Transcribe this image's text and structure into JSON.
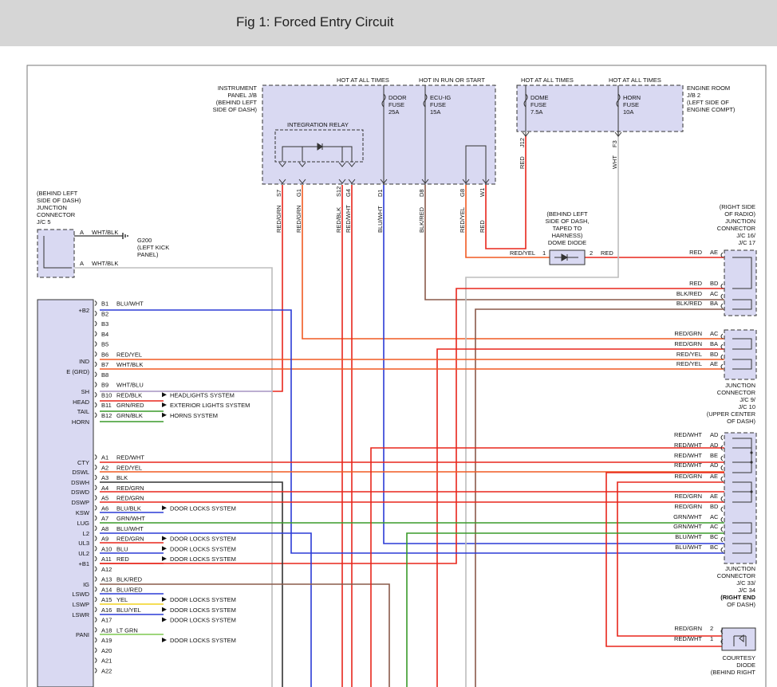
{
  "page_title": "Fig 1: Forced Entry Circuit",
  "boxes": {
    "ip_jb": [
      "INSTRUMENT",
      "PANEL J/B",
      "(BEHIND LEFT",
      "SIDE OF DASH)"
    ],
    "ip_hot1": "HOT AT ALL TIMES",
    "ip_hot2": "HOT IN RUN OR START",
    "door_fuse": [
      "DOOR",
      "FUSE",
      "25A"
    ],
    "ecu_fuse": [
      "ECU-IG",
      "FUSE",
      "15A"
    ],
    "integration_relay": "INTEGRATION RELAY",
    "er_hot1": "HOT AT ALL TIMES",
    "er_hot2": "HOT AT ALL TIMES",
    "dome_fuse": [
      "DOME",
      "FUSE",
      "7.5A"
    ],
    "horn_fuse": [
      "HORN",
      "FUSE",
      "10A"
    ],
    "er_jb": [
      "ENGINE ROOM",
      "J/B 2",
      "(LEFT SIDE OF",
      "ENGINE COMPT)"
    ],
    "jc5": [
      "(BEHIND LEFT",
      "SIDE OF DASH)",
      "JUNCTION",
      "CONNECTOR",
      "J/C 5"
    ],
    "g200": [
      "G200",
      "(LEFT KICK",
      "PANEL)"
    ],
    "dome_diode": [
      "(BEHIND LEFT",
      "SIDE OF DASH,",
      "TAPED TO",
      "HARNESS)",
      "DOME DIODE"
    ],
    "jc16": [
      "(RIGHT SIDE",
      "OF RADIO)",
      "JUNCTION",
      "CONNECTOR",
      "J/C 16/",
      "J/C 17"
    ],
    "jc9": [
      "JUNCTION",
      "CONNECTOR",
      "J/C 9/",
      "J/C 10",
      "(UPPER CENTER",
      "OF DASH)"
    ],
    "jc33": [
      "JUNCTION",
      "CONNECTOR",
      "J/C 33/",
      "J/C 34",
      "(RIGHT END",
      "OF DASH)"
    ],
    "courtesy": [
      "COURTESY",
      "DIODE",
      "(BEHIND RIGHT"
    ]
  },
  "top_pins": [
    {
      "pin": "S7",
      "wire": "RED/GRN"
    },
    {
      "pin": "G1",
      "wire": "RED/GRN"
    },
    {
      "pin": "S12",
      "wire": "RED/BLK"
    },
    {
      "pin": "G4",
      "wire": "RED/WHT"
    },
    {
      "pin": "D1",
      "wire": "BLU/WHT"
    },
    {
      "pin": "D8",
      "wire": "BLK/RED"
    },
    {
      "pin": "G8",
      "wire": "RED/YEL"
    },
    {
      "pin": "W1",
      "wire": "RED"
    },
    {
      "pin": "J12",
      "wire": "RED"
    },
    {
      "pin": "F3",
      "wire": "WHT"
    }
  ],
  "jc5_wires": [
    {
      "pin": "A",
      "wire": "WHT/BLK"
    },
    {
      "pin": "A",
      "wire": "WHT/BLK"
    }
  ],
  "dome_diode_pins": {
    "left_pin": "1",
    "left_wire": "RED/YEL",
    "right_pin": "2",
    "right_wire": "RED"
  },
  "ecu_side_labels": [
    "+B2",
    "IND",
    "E (GRD)",
    "SH",
    "HEAD",
    "TAIL",
    "HORN",
    "CTY",
    "DSWL",
    "DSWH",
    "DSWD",
    "DSWP",
    "KSW",
    "LUG",
    "L2",
    "UL3",
    "UL2",
    "+B1",
    "IG",
    "LSWD",
    "LSWP",
    "LSWR",
    "PANI"
  ],
  "ecu_pins": [
    {
      "pin": "B1",
      "wire": "BLU/WHT"
    },
    {
      "pin": "B2",
      "wire": ""
    },
    {
      "pin": "B3",
      "wire": ""
    },
    {
      "pin": "B4",
      "wire": ""
    },
    {
      "pin": "B5",
      "wire": ""
    },
    {
      "pin": "B6",
      "wire": "RED/YEL"
    },
    {
      "pin": "B7",
      "wire": "WHT/BLK"
    },
    {
      "pin": "B8",
      "wire": ""
    },
    {
      "pin": "B9",
      "wire": "WHT/BLU"
    },
    {
      "pin": "B10",
      "wire": "RED/BLK",
      "dest": "HEADLIGHTS SYSTEM"
    },
    {
      "pin": "B11",
      "wire": "GRN/RED",
      "dest": "EXTERIOR LIGHTS SYSTEM"
    },
    {
      "pin": "B12",
      "wire": "GRN/BLK",
      "dest": "HORNS SYSTEM"
    },
    {
      "pin": "A1",
      "wire": "RED/WHT"
    },
    {
      "pin": "A2",
      "wire": "RED/YEL"
    },
    {
      "pin": "A3",
      "wire": "BLK"
    },
    {
      "pin": "A4",
      "wire": "RED/GRN"
    },
    {
      "pin": "A5",
      "wire": "RED/GRN"
    },
    {
      "pin": "A6",
      "wire": "BLU/BLK",
      "dest": "DOOR LOCKS SYSTEM"
    },
    {
      "pin": "A7",
      "wire": "GRN/WHT"
    },
    {
      "pin": "A8",
      "wire": "BLU/WHT"
    },
    {
      "pin": "A9",
      "wire": "RED/GRN",
      "dest": "DOOR LOCKS SYSTEM"
    },
    {
      "pin": "A10",
      "wire": "BLU",
      "dest": "DOOR LOCKS SYSTEM"
    },
    {
      "pin": "A11",
      "wire": "RED",
      "dest": "DOOR LOCKS SYSTEM"
    },
    {
      "pin": "A12",
      "wire": ""
    },
    {
      "pin": "A13",
      "wire": "BLK/RED"
    },
    {
      "pin": "A14",
      "wire": "BLU/RED"
    },
    {
      "pin": "A15",
      "wire": "YEL",
      "dest": "DOOR LOCKS SYSTEM"
    },
    {
      "pin": "A16",
      "wire": "BLU/YEL",
      "dest": "DOOR LOCKS SYSTEM"
    },
    {
      "pin": "A17",
      "wire": "",
      "dest": "DOOR LOCKS SYSTEM"
    },
    {
      "pin": "A18",
      "wire": "LT GRN"
    },
    {
      "pin": "A19",
      "wire": "",
      "dest": "DOOR LOCKS SYSTEM"
    },
    {
      "pin": "A20",
      "wire": ""
    },
    {
      "pin": "A21",
      "wire": ""
    },
    {
      "pin": "A22",
      "wire": ""
    }
  ],
  "jc16_pins": [
    {
      "wire": "RED",
      "pin": "AE"
    },
    {
      "wire": "RED",
      "pin": "BD"
    },
    {
      "wire": "BLK/RED",
      "pin": "AC"
    },
    {
      "wire": "BLK/RED",
      "pin": "BA"
    }
  ],
  "jc9_pins": [
    {
      "wire": "RED/GRN",
      "pin": "AC"
    },
    {
      "wire": "RED/GRN",
      "pin": "BA"
    },
    {
      "wire": "RED/YEL",
      "pin": "BD"
    },
    {
      "wire": "RED/YEL",
      "pin": "AE"
    }
  ],
  "jc33_pins": [
    {
      "wire": "RED/WHT",
      "pin": "AD"
    },
    {
      "wire": "RED/WHT",
      "pin": "AD"
    },
    {
      "wire": "RED/WHT",
      "pin": "BE"
    },
    {
      "wire": "RED/WHT",
      "pin": "AD"
    },
    {
      "wire": "RED/GRN",
      "pin": "AE"
    },
    {
      "wire": "RED/GRN",
      "pin": "AE"
    },
    {
      "wire": "RED/GRN",
      "pin": "BD"
    },
    {
      "wire": "GRN/WHT",
      "pin": "AC"
    },
    {
      "wire": "GRN/WHT",
      "pin": "AC"
    },
    {
      "wire": "BLU/WHT",
      "pin": "BC"
    },
    {
      "wire": "BLU/WHT",
      "pin": "BC"
    }
  ],
  "courtesy_pins": [
    {
      "wire": "RED/GRN",
      "pin": "2"
    },
    {
      "wire": "RED/WHT",
      "pin": "1"
    }
  ],
  "colors": {
    "box_fill": "#d9d9f2",
    "red": "#e8261c",
    "orange": "#f05a22",
    "blue": "#2b3bd6",
    "green": "#3a9a2a",
    "light_green": "#7ec850",
    "yellow": "#f2d21e",
    "gray": "#bdbdbd",
    "light_blue": "#a9b7e8",
    "brown": "#8a5a4a",
    "dark": "#333333"
  }
}
